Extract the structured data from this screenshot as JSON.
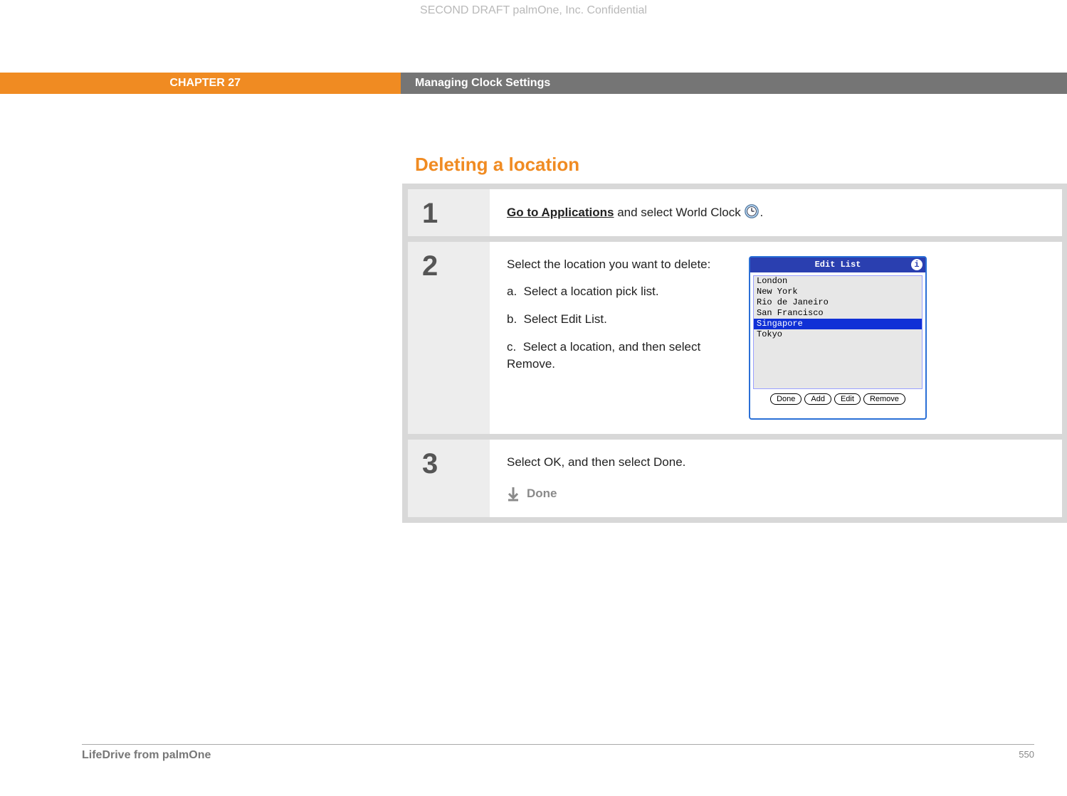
{
  "confidential": "SECOND DRAFT palmOne, Inc.  Confidential",
  "chapter": {
    "label": "CHAPTER 27",
    "title": "Managing Clock Settings"
  },
  "section_title": "Deleting a location",
  "steps": {
    "s1": {
      "num": "1",
      "link": "Go to Applications",
      "rest": " and select World Clock ",
      "period": "."
    },
    "s2": {
      "num": "2",
      "intro": "Select the location you want to delete:",
      "a_label": "a.",
      "a_text": "Select a location pick list.",
      "b_label": "b.",
      "b_text": "Select Edit List.",
      "c_label": "c.",
      "c_text": "Select a location, and then select Remove."
    },
    "s3": {
      "num": "3",
      "text": "Select OK, and then select Done.",
      "done": "Done"
    }
  },
  "device": {
    "title": "Edit List",
    "items": [
      "London",
      "New York",
      "Rio de Janeiro",
      "San Francisco",
      "Singapore",
      "Tokyo"
    ],
    "selected_index": 4,
    "buttons": {
      "done": "Done",
      "add": "Add",
      "edit": "Edit",
      "remove": "Remove"
    }
  },
  "footer": {
    "left": "LifeDrive from palmOne",
    "page": "550"
  }
}
